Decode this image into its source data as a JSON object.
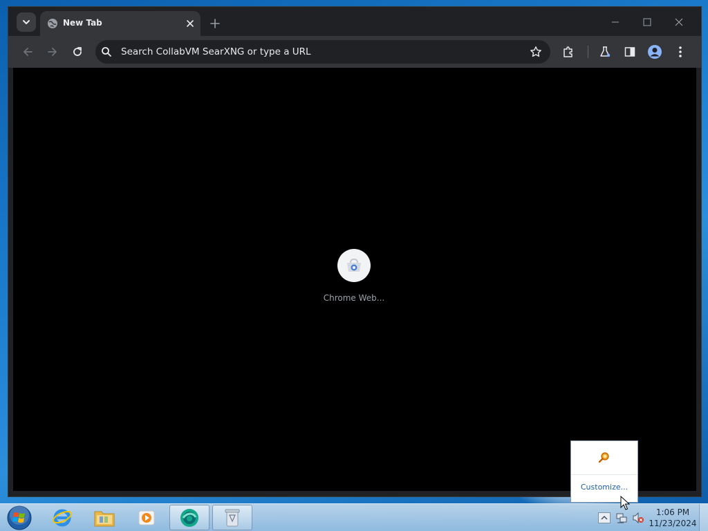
{
  "browser": {
    "tab": {
      "title": "New Tab",
      "favicon": "globe-icon"
    },
    "omnibox": {
      "placeholder": "Search CollabVM SearXNG or type a URL"
    },
    "toolbar_icons": [
      "back-icon",
      "forward-icon",
      "reload-icon",
      "star-icon",
      "extensions-icon",
      "labs-icon",
      "side-panel-icon",
      "profile-icon",
      "menu-icon"
    ],
    "window_controls": [
      "minimize-icon",
      "maximize-icon",
      "close-icon"
    ]
  },
  "new_tab_page": {
    "shortcuts": [
      {
        "label": "Chrome Web...",
        "icon": "chrome-web-store-icon"
      }
    ]
  },
  "tray_popup": {
    "icon": "magnifier-tool-icon",
    "customize_label": "Customize..."
  },
  "taskbar": {
    "apps": [
      {
        "name": "internet-explorer",
        "icon": "ie-icon"
      },
      {
        "name": "file-explorer",
        "icon": "folder-icon"
      },
      {
        "name": "media-player",
        "icon": "media-player-icon"
      },
      {
        "name": "chrome",
        "icon": "chrome-icon",
        "active": true
      },
      {
        "name": "recycle",
        "icon": "recycle-app-icon",
        "active": true
      }
    ],
    "tray_icons": [
      "show-hidden-icons",
      "network-icon",
      "volume-muted-icon"
    ],
    "clock": {
      "time": "1:06 PM",
      "date": "11/23/2024"
    }
  },
  "colors": {
    "chrome_frame": "#202124",
    "chrome_toolbar": "#35363a",
    "ntp_background": "#000000",
    "desktop": "#1d7fd0"
  }
}
